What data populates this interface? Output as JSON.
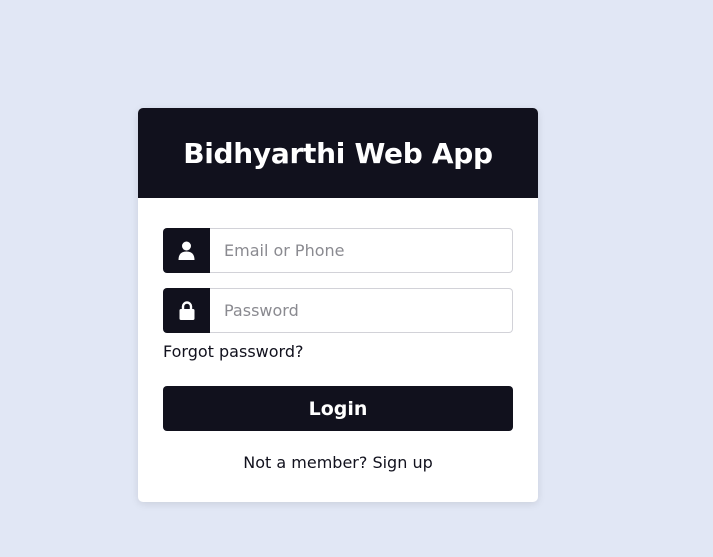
{
  "card": {
    "title": "Bidhyarthi Web App"
  },
  "form": {
    "email": {
      "placeholder": "Email or Phone",
      "value": "",
      "icon": "user-icon"
    },
    "password": {
      "placeholder": "Password",
      "value": "",
      "icon": "lock-icon"
    },
    "forgot_password_label": "Forgot password?",
    "login_label": "Login",
    "signup_prompt": "Not a member?",
    "signup_link_label": "Sign up"
  },
  "colors": {
    "background": "#e1e7f5",
    "primary_dark": "#11111d",
    "card_background": "#ffffff"
  }
}
